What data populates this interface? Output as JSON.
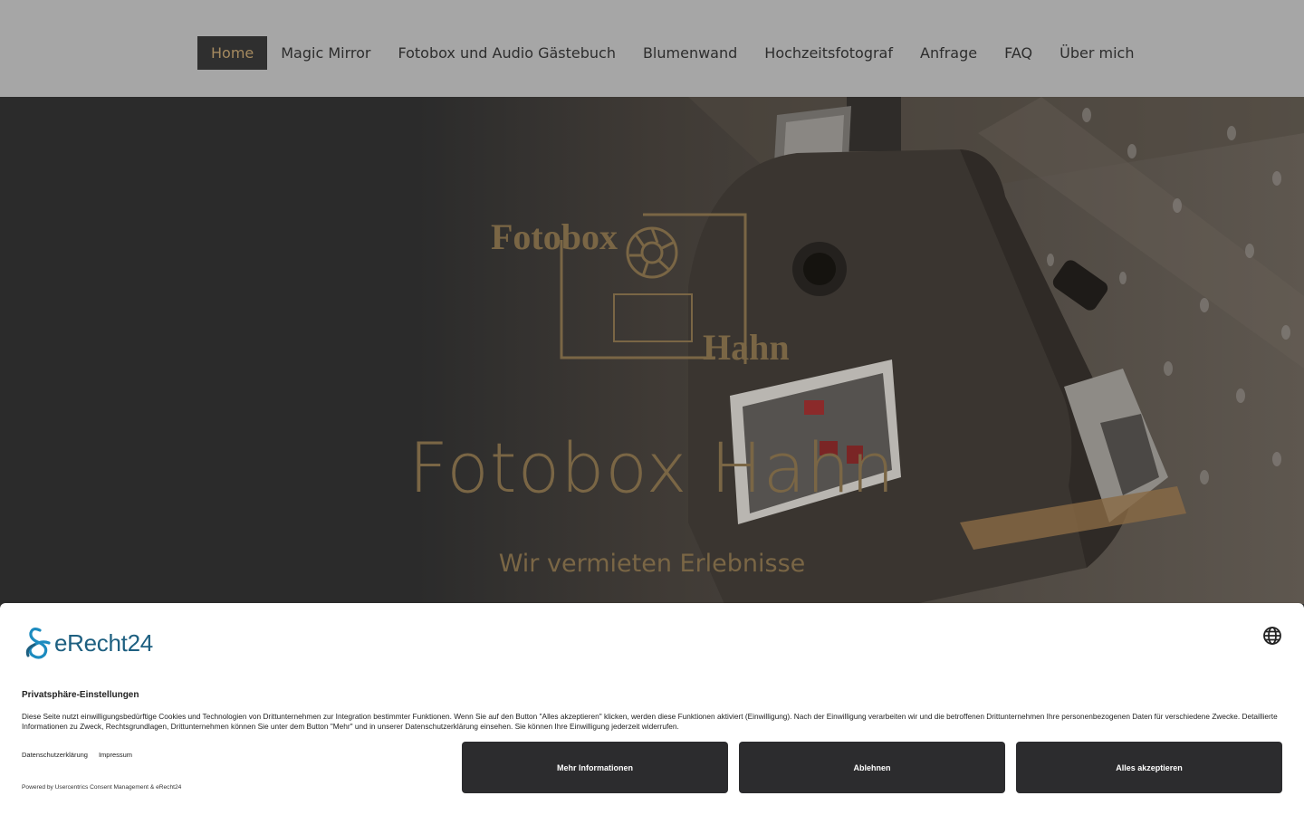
{
  "nav": {
    "items": [
      {
        "label": "Home",
        "active": true
      },
      {
        "label": "Magic Mirror"
      },
      {
        "label": "Fotobox und Audio Gästebuch"
      },
      {
        "label": "Blumenwand"
      },
      {
        "label": "Hochzeitsfotograf"
      },
      {
        "label": "Anfrage"
      },
      {
        "label": "FAQ"
      },
      {
        "label": "Über mich"
      }
    ]
  },
  "hero": {
    "logo_text_top": "Fotobox",
    "logo_text_bottom": "Hahn",
    "title": "Fotobox Hahn",
    "subtitle": "Wir vermieten Erlebnisse"
  },
  "consent": {
    "brand": "eRecht24",
    "globe_icon": "globe-icon",
    "title": "Privatsphäre-Einstellungen",
    "text": "Diese Seite nutzt einwilligungsbedürftige Cookies und Technologien von Drittunternehmen zur Integration bestimmter Funktionen. Wenn Sie auf den Button \"Alles akzeptieren\" klicken, werden diese Funktionen aktiviert (Einwilligung). Nach der Einwilligung verarbeiten wir und die betroffenen Drittunternehmen Ihre personenbezogenen Daten für verschiedene Zwecke. Detaillierte Informationen zu Zweck, Rechtsgrundlagen, Drittunternehmen können Sie unter dem Button \"Mehr\" und in unserer Datenschutzerklärung einsehen. Sie können Ihre Einwilligung jederzeit widerrufen.",
    "links": [
      "Datenschutzerklärung",
      "Impressum"
    ],
    "powered_by": "Powered by Usercentrics Consent Management & eRecht24",
    "buttons": {
      "more": "Mehr Informationen",
      "deny": "Ablehnen",
      "accept": "Alles akzeptieren"
    }
  },
  "colors": {
    "topbar": "#a6a6a6",
    "hero_bg": "#2b2b2b",
    "gold": "#7a6645",
    "brand_blue": "#1d5f80",
    "button_dark": "#2c2c2e"
  }
}
